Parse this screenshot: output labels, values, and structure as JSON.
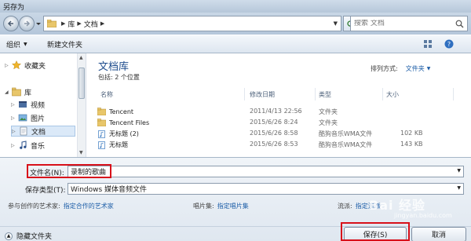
{
  "window": {
    "title": "另存为"
  },
  "address": {
    "crumbs": [
      "库",
      "文档"
    ],
    "search_placeholder": "搜索 文档"
  },
  "toolbar": {
    "organize": "组织",
    "new_folder": "新建文件夹"
  },
  "sidebar": {
    "favorites": "收藏夹",
    "libraries": "库",
    "items": [
      {
        "label": "视频",
        "icon": "video-icon"
      },
      {
        "label": "图片",
        "icon": "picture-icon"
      },
      {
        "label": "文档",
        "icon": "document-icon"
      },
      {
        "label": "音乐",
        "icon": "music-icon"
      }
    ]
  },
  "main": {
    "library_title": "文档库",
    "includes": "包括: 2 个位置",
    "arrange_label": "排列方式:",
    "arrange_value": "文件夹",
    "columns": {
      "name": "名称",
      "modified": "修改日期",
      "type": "类型",
      "size": "大小"
    },
    "rows": [
      {
        "name": "Tencent",
        "modified": "2011/4/13 22:56",
        "type": "文件夹",
        "size": "",
        "icon": "folder-icon"
      },
      {
        "name": "Tencent Files",
        "modified": "2015/6/26 8:24",
        "type": "文件夹",
        "size": "",
        "icon": "folder-icon"
      },
      {
        "name": "无标题 (2)",
        "modified": "2015/6/26 8:58",
        "type": "酷狗音乐WMA文件",
        "size": "102 KB",
        "icon": "audio-file-icon"
      },
      {
        "name": "无标题",
        "modified": "2015/6/26 8:53",
        "type": "酷狗音乐WMA文件",
        "size": "143 KB",
        "icon": "audio-file-icon"
      }
    ]
  },
  "save_form": {
    "filename_label": "文件名(N):",
    "filename_value": "录制的歌曲",
    "type_label": "保存类型(T):",
    "type_value": "Windows 媒体音频文件",
    "artist_label": "参与创作的艺术家:",
    "artist_value": "指定合作的艺术家",
    "album_label": "唱片集:",
    "album_value": "指定唱片集",
    "genre_label": "流派:",
    "genre_value": "指定流派",
    "hide_folders": "隐藏文件夹",
    "save_button": "保存(S)",
    "cancel_button": "取消"
  },
  "watermark": {
    "text": "Bai 经验",
    "sub": "jingyan.baidu.com"
  },
  "colors": {
    "accent": "#1f5fa8",
    "highlight": "#d8101a"
  }
}
